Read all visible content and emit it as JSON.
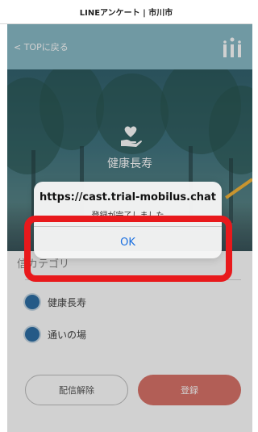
{
  "status_bar": {
    "title": "LINEアンケート | 市川市"
  },
  "header": {
    "back_label": "< TOPに戻る",
    "logo_icon": "logo-bars-icon"
  },
  "hero": {
    "title": "健康長寿",
    "icon": "heart-hand-icon"
  },
  "section": {
    "label": "信カテゴリ",
    "options": [
      {
        "label": "健康長寿",
        "selected": true
      },
      {
        "label": "通いの場",
        "selected": true
      }
    ]
  },
  "buttons": {
    "unsubscribe": "配信解除",
    "register": "登録"
  },
  "dialog": {
    "title": "https://cast.trial-mobilus.chat",
    "message": "登録が完了しました",
    "ok_label": "OK"
  },
  "colors": {
    "accent": "#4a96a9",
    "register": "#d9736a",
    "radio": "#2e6ea5",
    "ok": "#1a6fe0",
    "highlight": "#e8191c"
  }
}
